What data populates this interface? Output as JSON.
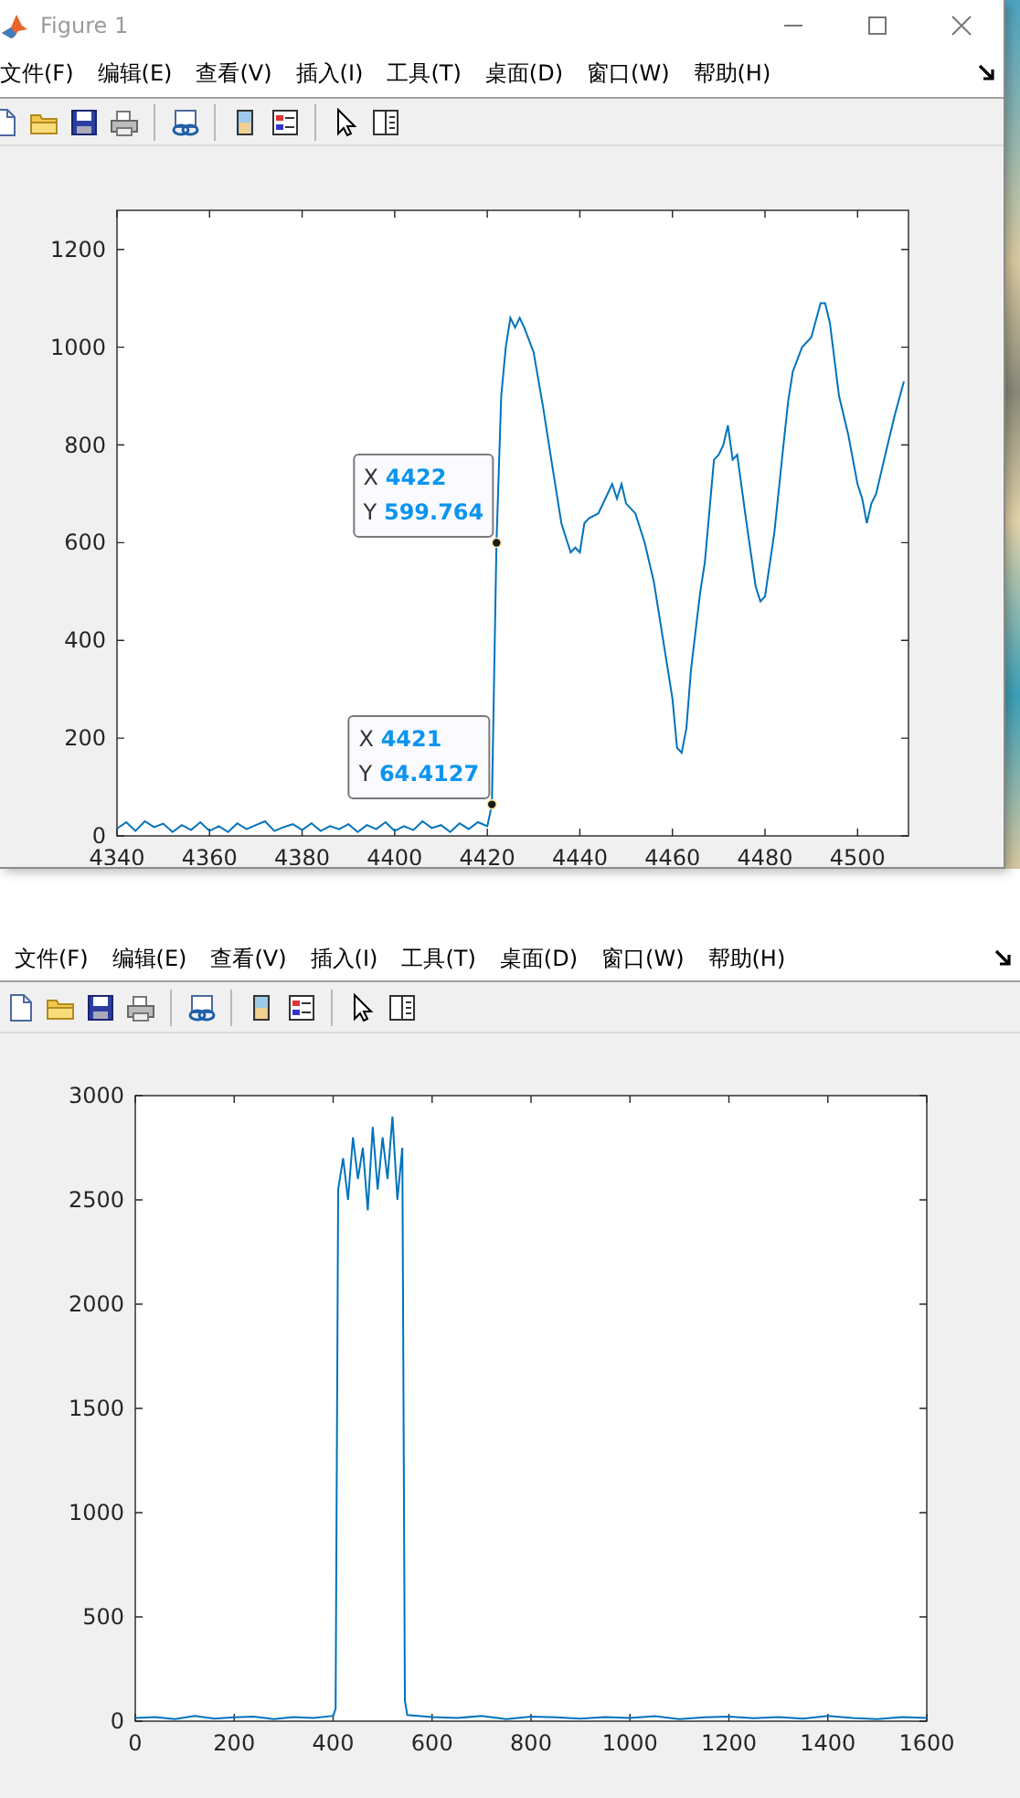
{
  "windows": [
    {
      "title": "Figure 1",
      "menu": [
        "文件(F)",
        "编辑(E)",
        "查看(V)",
        "插入(I)",
        "工具(T)",
        "桌面(D)",
        "窗口(W)",
        "帮助(H)"
      ],
      "chart_data": {
        "type": "line",
        "xlim": [
          4340,
          4511
        ],
        "ylim": [
          0,
          1280
        ],
        "xticks": [
          4340,
          4360,
          4380,
          4400,
          4420,
          4440,
          4460,
          4480,
          4500
        ],
        "yticks": [
          0,
          200,
          400,
          600,
          800,
          1000,
          1200
        ],
        "x": [
          4340,
          4342,
          4344,
          4346,
          4348,
          4350,
          4352,
          4354,
          4356,
          4358,
          4360,
          4362,
          4364,
          4366,
          4368,
          4370,
          4372,
          4374,
          4376,
          4378,
          4380,
          4382,
          4384,
          4386,
          4388,
          4390,
          4392,
          4394,
          4396,
          4398,
          4400,
          4402,
          4404,
          4406,
          4408,
          4410,
          4412,
          4414,
          4416,
          4418,
          4420,
          4421,
          4422,
          4423,
          4424,
          4425,
          4426,
          4427,
          4428,
          4430,
          4432,
          4434,
          4436,
          4437,
          4438,
          4439,
          4440,
          4441,
          4442,
          4444,
          4446,
          4447,
          4448,
          4449,
          4450,
          4452,
          4454,
          4456,
          4458,
          4460,
          4461,
          4462,
          4463,
          4464,
          4466,
          4467,
          4469,
          4470,
          4471,
          4472,
          4473,
          4474,
          4476,
          4478,
          4479,
          4480,
          4482,
          4484,
          4485,
          4486,
          4488,
          4490,
          4492,
          4493,
          4494,
          4496,
          4498,
          4500,
          4501,
          4502,
          4503,
          4504,
          4506,
          4508,
          4510
        ],
        "series": [
          {
            "color": "#0072bd",
            "values": [
              15,
              28,
              10,
              30,
              18,
              25,
              8,
              22,
              12,
              28,
              10,
              20,
              8,
              26,
              14,
              22,
              30,
              10,
              18,
              24,
              12,
              26,
              10,
              20,
              14,
              24,
              8,
              22,
              14,
              28,
              10,
              20,
              12,
              30,
              16,
              22,
              8,
              26,
              14,
              28,
              20,
              64,
              600,
              900,
              1000,
              1060,
              1040,
              1060,
              1040,
              990,
              880,
              760,
              640,
              610,
              580,
              590,
              580,
              640,
              650,
              660,
              700,
              720,
              690,
              720,
              680,
              660,
              600,
              520,
              400,
              280,
              180,
              170,
              220,
              340,
              500,
              560,
              770,
              780,
              800,
              840,
              770,
              780,
              640,
              510,
              480,
              490,
              620,
              800,
              890,
              950,
              1000,
              1020,
              1090,
              1090,
              1050,
              900,
              820,
              720,
              690,
              640,
              680,
              700,
              780,
              860,
              930
            ]
          }
        ]
      },
      "datatips": [
        {
          "x_label": "X",
          "x_value": "4422",
          "y_label": "Y",
          "y_value": "599.764"
        },
        {
          "x_label": "X",
          "x_value": "4421",
          "y_label": "Y",
          "y_value": "64.4127"
        }
      ]
    },
    {
      "menu": [
        "文件(F)",
        "编辑(E)",
        "查看(V)",
        "插入(I)",
        "工具(T)",
        "桌面(D)",
        "窗口(W)",
        "帮助(H)"
      ],
      "chart_data": {
        "type": "line",
        "xlim": [
          0,
          1600
        ],
        "ylim": [
          0,
          3000
        ],
        "xticks": [
          0,
          200,
          400,
          600,
          800,
          1000,
          1200,
          1400,
          1600
        ],
        "yticks": [
          0,
          500,
          1000,
          1500,
          2000,
          2500,
          3000
        ],
        "x": [
          0,
          40,
          80,
          120,
          160,
          200,
          240,
          280,
          320,
          360,
          400,
          405,
          410,
          420,
          430,
          440,
          450,
          460,
          470,
          480,
          490,
          500,
          510,
          520,
          530,
          540,
          545,
          550,
          600,
          650,
          700,
          750,
          800,
          850,
          900,
          950,
          1000,
          1050,
          1100,
          1150,
          1200,
          1250,
          1300,
          1350,
          1400,
          1450,
          1500,
          1550,
          1600
        ],
        "series": [
          {
            "color": "#0072bd",
            "values": [
              15,
              20,
              10,
              25,
              12,
              18,
              22,
              10,
              20,
              15,
              25,
              60,
              2550,
              2700,
              2500,
              2800,
              2600,
              2750,
              2450,
              2850,
              2550,
              2800,
              2600,
              2900,
              2500,
              2750,
              100,
              30,
              20,
              15,
              25,
              10,
              22,
              18,
              12,
              20,
              15,
              24,
              10,
              18,
              22,
              14,
              20,
              12,
              25,
              16,
              10,
              20,
              15
            ]
          }
        ]
      }
    }
  ]
}
